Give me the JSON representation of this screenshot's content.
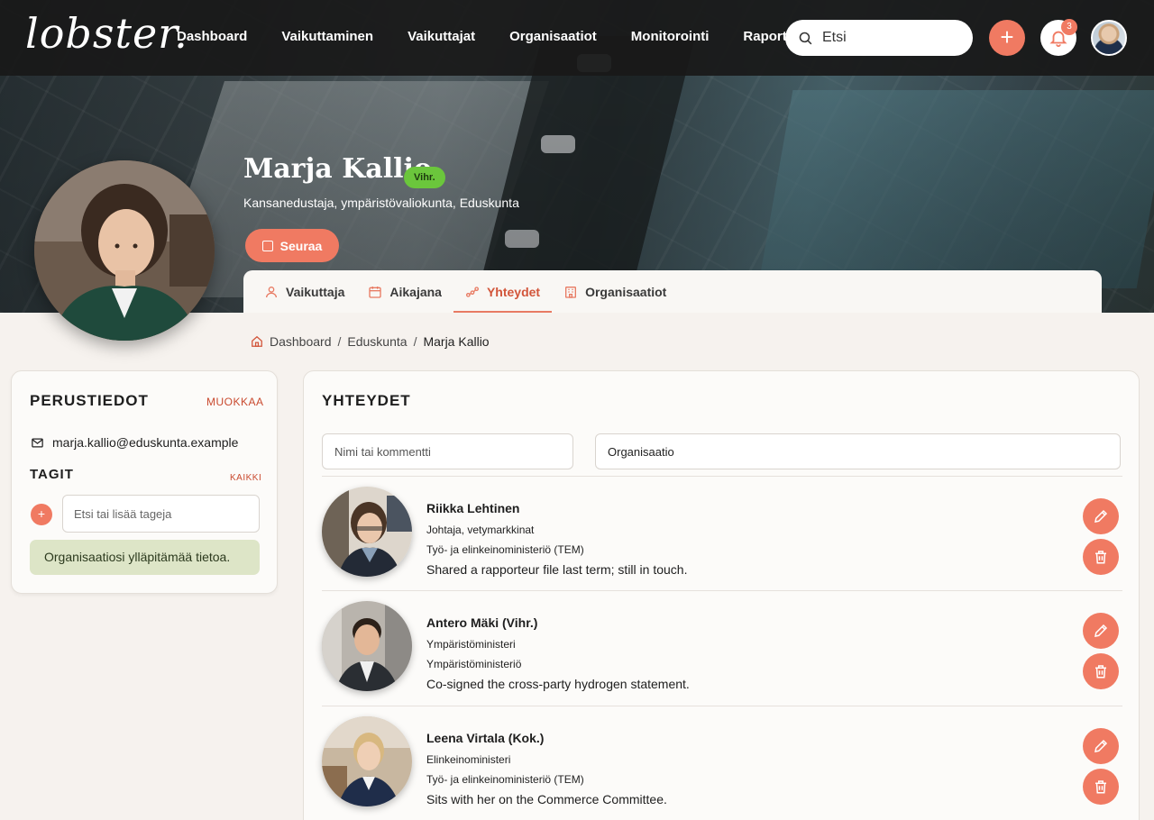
{
  "brand": {
    "logo_text": "lobster."
  },
  "nav": {
    "items": [
      {
        "label": "Dashboard"
      },
      {
        "label": "Vaikuttaminen"
      },
      {
        "label": "Vaikuttajat"
      },
      {
        "label": "Organisaatiot"
      },
      {
        "label": "Monitorointi"
      },
      {
        "label": "Raportit"
      }
    ]
  },
  "search": {
    "placeholder": "Etsi"
  },
  "actions": {
    "add_label": "+",
    "notification_count": "3"
  },
  "profile": {
    "name": "Marja Kallio",
    "party": "Vihr.",
    "title": "Kansanedustaja, ympäristövaliokunta, Eduskunta",
    "follow_label": "Seuraa"
  },
  "tabs": [
    {
      "label": "Vaikuttaja",
      "icon": "user-icon"
    },
    {
      "label": "Aikajana",
      "icon": "calendar-icon"
    },
    {
      "label": "Yhteydet",
      "icon": "network-icon",
      "active": true
    },
    {
      "label": "Organisaatiot",
      "icon": "building-icon"
    }
  ],
  "breadcrumb": {
    "items": [
      {
        "label": "Dashboard"
      },
      {
        "label": "Eduskunta"
      }
    ],
    "current": "Marja Kallio"
  },
  "basic_info": {
    "heading": "PERUSTIEDOT",
    "edit_label": "MUOKKAA",
    "email": "marja.kallio@eduskunta.example",
    "tags_heading": "TAGIT",
    "tags_all_label": "KAIKKI",
    "tag_add_label": "+",
    "tag_placeholder": "Etsi tai lisää tageja",
    "note": "Organisaatiosi ylläpitämää tietoa."
  },
  "connections": {
    "heading": "YHTEYDET",
    "filter_name_placeholder": "Nimi tai kommentti",
    "filter_org_value": "Organisaatio",
    "items": [
      {
        "name": "Riikka Lehtinen",
        "role": "Johtaja, vetymarkkinat",
        "org": "Työ- ja elinkeinoministeriö (TEM)",
        "comment": "Shared a rapporteur file last term; still in touch."
      },
      {
        "name": "Antero Mäki (Vihr.)",
        "role": "Ympäristöministeri",
        "org": "Ympäristöministeriö",
        "comment": "Co-signed the cross-party hydrogen statement."
      },
      {
        "name": "Leena Virtala (Kok.)",
        "role": "Elinkeinoministeri",
        "org": "Työ- ja elinkeinoministeriö (TEM)",
        "comment": "Sits with her on the Commerce Committee."
      }
    ]
  },
  "colors": {
    "accent": "#f07a62",
    "accent_text": "#d2553a",
    "party_green": "#6bc63c",
    "note_bg": "#dde5c7"
  }
}
